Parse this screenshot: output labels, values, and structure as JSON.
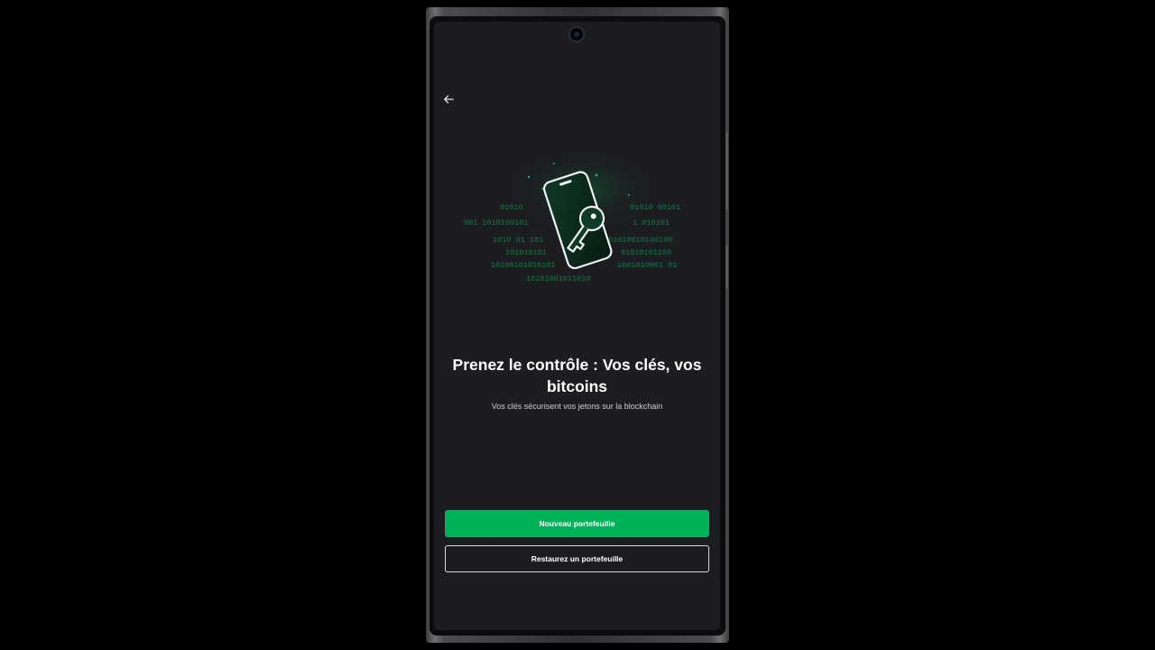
{
  "colors": {
    "background": "#000000",
    "screen": "#1c1d21",
    "accent": "#00b35a",
    "text": "#ffffff",
    "subtext": "#c9cbd0"
  },
  "icons": {
    "back": "arrow-left-icon",
    "illustration": "phone-with-keys-illustration"
  },
  "onboarding": {
    "title": "Prenez le contrôle : Vos clés, vos bitcoins",
    "subtitle": "Vos clés sécurisent vos jetons sur la blockchain"
  },
  "actions": {
    "new_wallet_label": "Nouveau portefeuille",
    "restore_wallet_label": "Restaurez un portefeuille"
  }
}
